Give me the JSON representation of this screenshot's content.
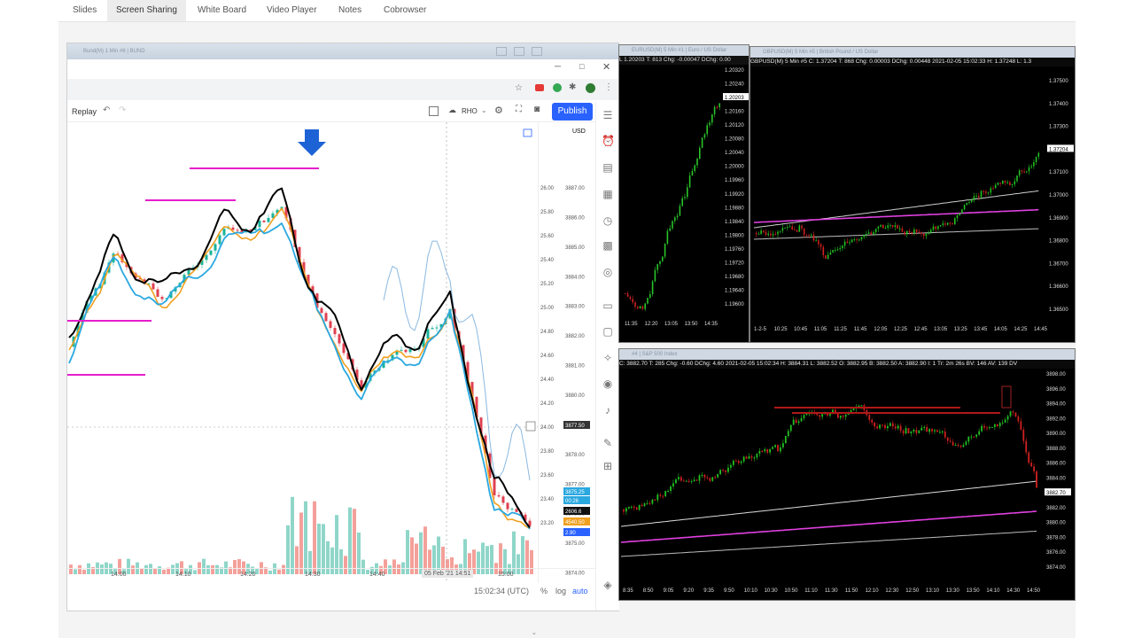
{
  "nav": {
    "tabs": [
      {
        "label": "Slides",
        "active": false
      },
      {
        "label": "Screen Sharing",
        "active": true
      },
      {
        "label": "White Board",
        "active": false
      },
      {
        "label": "Video Player",
        "active": false
      },
      {
        "label": "Notes",
        "active": false
      },
      {
        "label": "Cobrowser",
        "active": false
      }
    ]
  },
  "tradingview": {
    "window_title": "Bund(M) 1 Min #6 | BUND",
    "replay_label": "Replay",
    "indicator_label": "RHO",
    "publish_label": "Publish",
    "currency": "USD",
    "time_readout": "15:02:34 (UTC)",
    "scale_percent": "%",
    "scale_log": "log",
    "scale_auto": "auto",
    "left_axis": [
      "26.00",
      "25.80",
      "25.60",
      "25.40",
      "25.20",
      "25.00",
      "24.80",
      "24.60",
      "24.40",
      "24.20",
      "24.00",
      "23.80",
      "23.60",
      "23.40",
      "23.20"
    ],
    "right_axis": [
      "3887.00",
      "3886.00",
      "3885.00",
      "3884.00",
      "3883.00",
      "3882.00",
      "3881.00",
      "3880.00",
      "3879.00",
      "3878.00",
      "3877.00",
      "3876.00",
      "3875.00",
      "3874.00",
      "3873.00"
    ],
    "crosshair_price": "3877.50",
    "price_badges": [
      "3875.25",
      "00:26",
      "2606.6",
      "4540.50",
      "2.90"
    ],
    "time_axis": [
      "14:00",
      "14:10",
      "14:20",
      "14:30",
      "14:40",
      "14:51",
      "15:00"
    ],
    "time_cursor": "05 Feb '21",
    "colors": {
      "accent": "#2962ff",
      "magenta": "#e61ecb",
      "orange": "#f0a020",
      "cyan": "#2aa8e0"
    }
  },
  "eurusd": {
    "title": "EURUSD(M) 5 Min #1 | Euro / US Dollar",
    "info": "L 1.20203  T: 813  Chg: -0.00047  DChg: 0.00",
    "axis": [
      "1.20320",
      "1.20240",
      "1.20203",
      "1.20160",
      "1.20120",
      "1.20080",
      "1.20040",
      "1.20000",
      "1.19960",
      "1.19920",
      "1.19880",
      "1.19840",
      "1.19800",
      "1.19760",
      "1.19720",
      "1.19680",
      "1.19640",
      "1.19600"
    ],
    "time_axis": [
      "11:35",
      "12:20",
      "13:05",
      "13:50",
      "14:35"
    ]
  },
  "gbpusd": {
    "title": "GBPUSD(M) 5 Min #5 | British Pound / US Dollar",
    "info": "GBPUSD(M) 5 Min  #5  C: 1.37204  T: 868  Chg: 0.00003  DChg: 0.00448  2021-02-05 15:02:33  H: 1.37248  L: 1.3",
    "axis": [
      "1.37500",
      "1.37400",
      "1.37300",
      "1.37204",
      "1.37100",
      "1.37000",
      "1.36900",
      "1.36800",
      "1.36700",
      "1.36600",
      "1.36500"
    ],
    "time_axis": [
      "1-2-5",
      "10:25",
      "10:45",
      "11:05",
      "11:25",
      "11:45",
      "12:05",
      "12:25",
      "12:45",
      "13:05",
      "13:25",
      "13:45",
      "14:05",
      "14:25",
      "14:45"
    ]
  },
  "spx": {
    "title": "#4 | S&P 500 Index",
    "info": "C: 3882.70  T: 285  Chg: -0.60  DChg: 4.60  2021-02-05 15:02:34  H: 3884.31  L: 3882.52  O: 3882.95  B: 3882.50  A: 3882.90  I: 1  Tr: 2m 26s  BV: 146  AV: 139  DV",
    "axis": [
      "3898.00",
      "3896.00",
      "3894.00",
      "3892.00",
      "3890.00",
      "3888.00",
      "3886.00",
      "3884.00",
      "3882.70",
      "3882.00",
      "3880.00",
      "3878.00",
      "3876.00",
      "3874.00"
    ],
    "time_axis": [
      "8:35",
      "8:50",
      "9:05",
      "9:20",
      "9:35",
      "9:50",
      "10:10",
      "10:30",
      "10:50",
      "11:10",
      "11:30",
      "11:50",
      "12:10",
      "12:30",
      "12:50",
      "13:10",
      "13:30",
      "13:50",
      "14:10",
      "14:30",
      "14:50"
    ]
  }
}
